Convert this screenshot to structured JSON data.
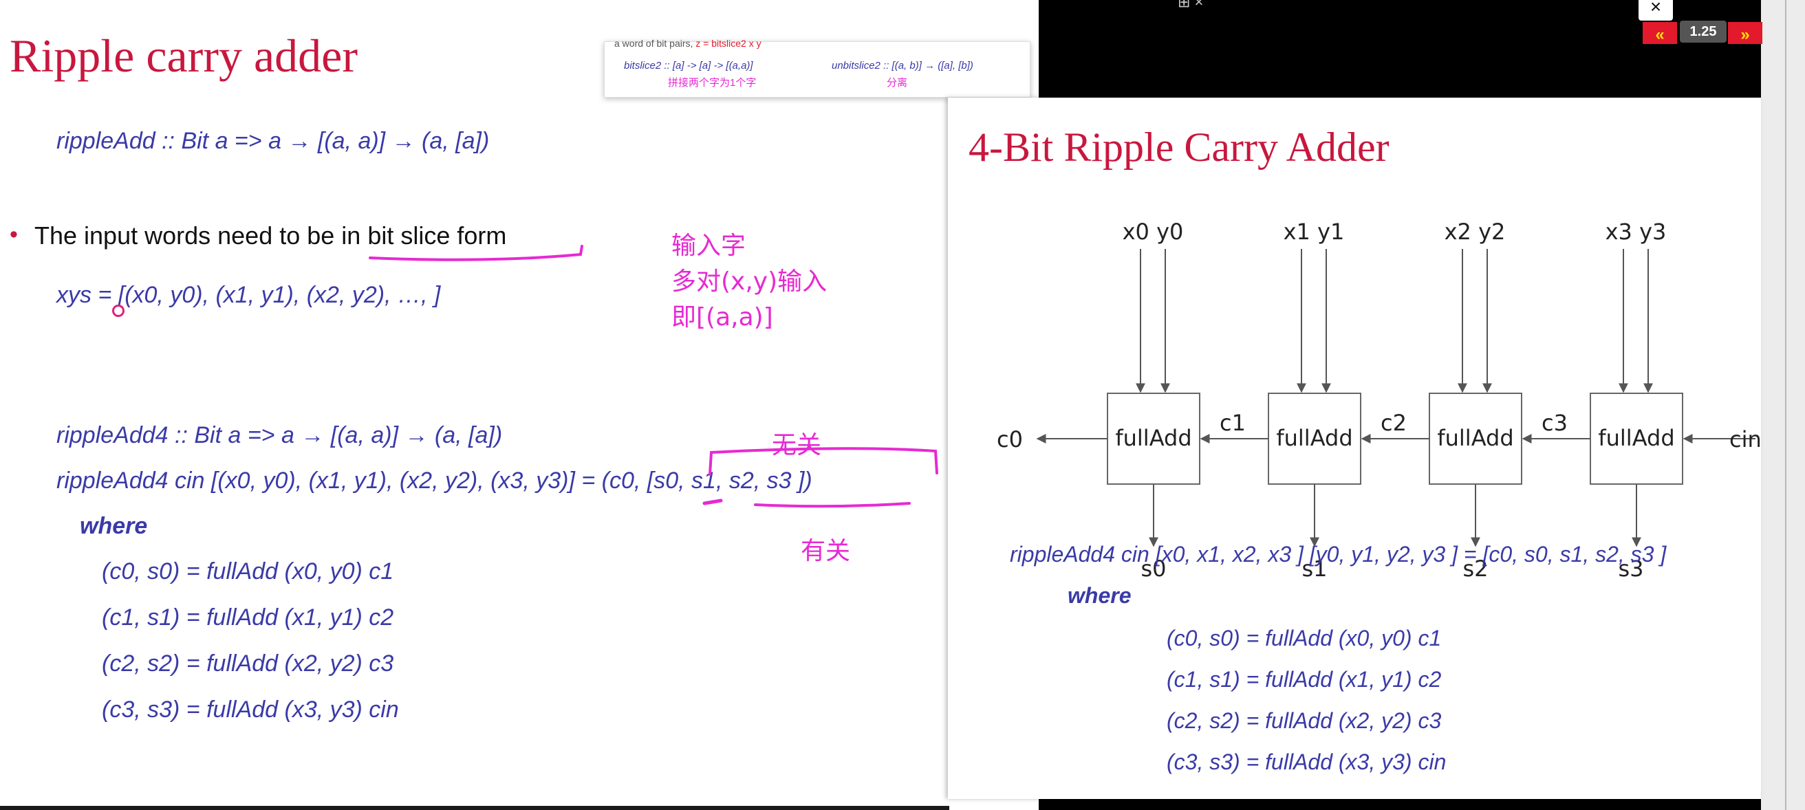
{
  "left_slide": {
    "title": "Ripple carry adder",
    "sig1": "rippleAdd :: Bit a => a → [(a, a)] → (a, [a])",
    "bullet": "The input words need to be in bit slice form",
    "xys": "xys = [(x0, y0), (x1, y1), (x2, y2), …, ]",
    "sig2": "rippleAdd4 :: Bit a => a → [(a, a)] → (a, [a])",
    "def_line": "rippleAdd4 cin [(x0, y0), (x1, y1), (x2, y2), (x3, y3)] = (c0, [s0, s1, s2, s3 ])",
    "where": "where",
    "eqs": [
      "(c0, s0) = fullAdd (x0, y0) c1",
      "(c1, s1) = fullAdd (x1, y1) c2",
      "(c2, s2) = fullAdd (x2, y2) c3",
      "(c3, s3) = fullAdd (x3, y3) cin"
    ],
    "notes": {
      "line1": "输入字",
      "line2": "多对(x,y)输入",
      "line3": "即[(a,a)]",
      "unrelated": "无关",
      "related": "有关"
    }
  },
  "tooltip": {
    "top_text": "a word of bit pairs,",
    "top_red": "z = bitslice2 x y",
    "left_sig": "bitslice2 :: [a] -> [a] -> [(a,a)]",
    "left_note": "拼接两个字为1个字",
    "right_sig": "unbitslice2 :: [(a, b)] → ([a], [b])",
    "right_note": "分离"
  },
  "right_slide": {
    "title": "4-Bit Ripple Carry Adder",
    "diagram": {
      "block_label": "fullAdd",
      "inputs": [
        "x0 y0",
        "x1 y1",
        "x2 y2",
        "x3 y3"
      ],
      "carries": [
        "c0",
        "c1",
        "c2",
        "c3",
        "cin"
      ],
      "sums": [
        "s0",
        "s1",
        "s2",
        "s3"
      ]
    },
    "def_line": "rippleAdd4 cin [x0, x1, x2, x3 ] [y0, y1, y2, y3 ] = [c0, s0, s1, s2, s3 ]",
    "where": "where",
    "eqs": [
      "(c0, s0) = fullAdd (x0, y0) c1",
      "(c1, s1) = fullAdd (x1, y1) c2",
      "(c2, s2) = fullAdd (x2, y2) c3",
      "(c3, s3) = fullAdd (x3, y3) cin"
    ]
  },
  "player": {
    "close": "×",
    "speed": "1.25",
    "prev": "«",
    "next": "»",
    "icons": "⊞ ×"
  }
}
